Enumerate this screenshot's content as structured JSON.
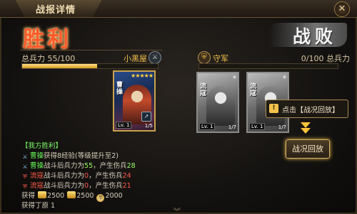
{
  "window": {
    "title": "战报详情"
  },
  "result": {
    "left": "胜利",
    "right": "战败"
  },
  "left_side": {
    "troops_label": "总兵力 55/100",
    "troops_fraction": 0.55,
    "player_name": "小黑屋"
  },
  "right_side": {
    "player_name": "守军",
    "troops_label": "0/100 总兵力",
    "troops_fraction": 0.0
  },
  "cards": {
    "hero": {
      "name": "曹操",
      "level": "Lv. 1",
      "foot": "1/5"
    },
    "enemy1": {
      "name": "流寇",
      "level": "Lv. 1",
      "foot": "1/7"
    },
    "enemy2": {
      "name": "流寇",
      "level": "Lv. 1",
      "foot": "1/7"
    }
  },
  "tooltip": {
    "text": "点击【战况回放】"
  },
  "replay_button": "战况回放",
  "log": {
    "header": "【我方胜利】",
    "lines": [
      {
        "name": "曹操",
        "text": "获得8经验(等级提升至2)"
      },
      {
        "name": "曹操",
        "text_a": "战斗后兵力为",
        "val_a": "55",
        "text_b": "，产生伤兵",
        "val_b": "28"
      },
      {
        "name": "流寇",
        "text_a": "战斗后兵力为",
        "val_a": "0",
        "text_b": "，产生伤兵",
        "val_b": "24"
      },
      {
        "name": "流寇",
        "text_a": "战斗后兵力为",
        "val_a": "0",
        "text_b": "，产生伤兵",
        "val_b": "21"
      }
    ],
    "rewards_label": "获得",
    "rewards": [
      "2500",
      "2500",
      "2000"
    ],
    "gain_line": "获得丁原 1"
  },
  "colors": {
    "victory": "#ff5a2a",
    "accent_gold": "#f3c24b",
    "green_text": "#6bff5a",
    "red_text": "#ff5a4a"
  }
}
